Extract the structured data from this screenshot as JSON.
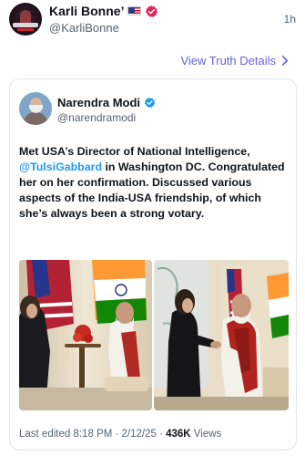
{
  "header": {
    "author_name": "Karli Bonne’",
    "author_handle": "@KarliBonne",
    "timestamp": "1h"
  },
  "view_truth_details": "View Truth Details",
  "quoted_post": {
    "author_name": "Narendra Modi",
    "author_handle": "@narendramodi",
    "text_before": "Met USA’s Director of National Intelligence, ",
    "mention": "@TulsiGabbard",
    "text_after": " in Washington DC. Congratulated her on her confirmation. Discussed various aspects of the India-USA friendship, of which she’s always been a strong votary.",
    "meta_prefix": "Last edited 8:18 PM · 2/12/25 · ",
    "views": "436K",
    "views_label": " Views"
  },
  "colors": {
    "link": "#6464d6",
    "mention": "#1d9bf0",
    "verified": "#1d9bf0",
    "flag_stripe": "#c8102e",
    "secondary_text": "#536471"
  },
  "icons": {
    "flag": "us-flag-icon",
    "verified_author": "verified-badge-icon",
    "verified_poster": "verified-badge-icon",
    "chevron": "chevron-right-icon"
  }
}
